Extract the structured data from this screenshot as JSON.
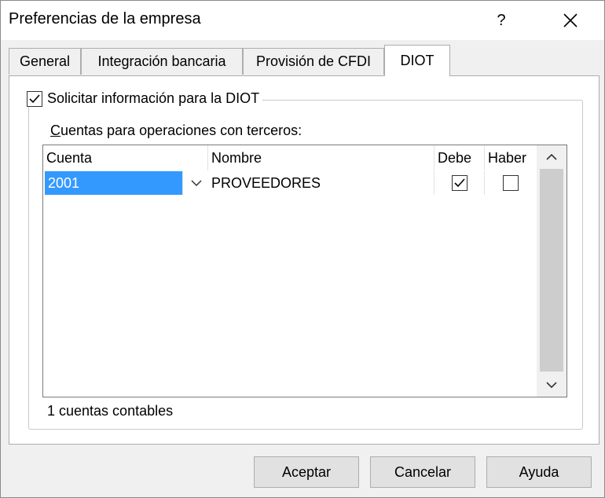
{
  "window": {
    "title": "Preferencias de la empresa",
    "help_glyph": "?"
  },
  "tabs": [
    {
      "label": "General",
      "active": false
    },
    {
      "label": "Integración bancaria",
      "active": false
    },
    {
      "label": "Provisión de CFDI",
      "active": false
    },
    {
      "label": "DIOT",
      "active": true
    }
  ],
  "diot": {
    "request_checkbox": {
      "label": "Solicitar información para la DIOT",
      "checked": true
    },
    "grid_caption_accesskey": "C",
    "grid_caption_rest": "uentas para operaciones con terceros:",
    "grid": {
      "columns": [
        "Cuenta",
        "Nombre",
        "Debe",
        "Haber"
      ],
      "rows": [
        {
          "cuenta": "2001",
          "nombre": "PROVEEDORES",
          "debe": true,
          "haber": false
        }
      ]
    },
    "status": "1 cuentas contables"
  },
  "buttons": {
    "ok": "Aceptar",
    "cancel": "Cancelar",
    "help": "Ayuda"
  },
  "colors": {
    "selection": "#3399ff",
    "window_bg": "#f0f0f0"
  },
  "icons": {
    "close": "close-icon",
    "check": "check-icon",
    "dropdown": "chevron-down-icon",
    "scroll_up": "chevron-up-icon",
    "scroll_down": "chevron-down-icon"
  }
}
